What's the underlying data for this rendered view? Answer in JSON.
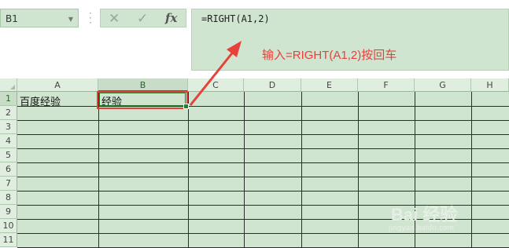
{
  "name_box": {
    "value": "B1"
  },
  "formula_bar": {
    "formula": "=RIGHT(A1,2)"
  },
  "annotation": {
    "text": "输入=RIGHT(A1,2)按回车",
    "color": "#e8413c"
  },
  "columns": [
    "A",
    "B",
    "C",
    "D",
    "E",
    "F",
    "G",
    "H"
  ],
  "rows": [
    "1",
    "2",
    "3",
    "4",
    "5",
    "6",
    "7",
    "8",
    "9",
    "10",
    "11"
  ],
  "cells": {
    "A1": "百度经验",
    "B1": "经验"
  },
  "selected_cell": "B1",
  "watermark": {
    "text": "Bai 经验",
    "sub": "jingyan.baidu.com"
  },
  "icons": {
    "cancel": "cross-icon",
    "confirm": "check-icon",
    "function": "fx-icon"
  }
}
